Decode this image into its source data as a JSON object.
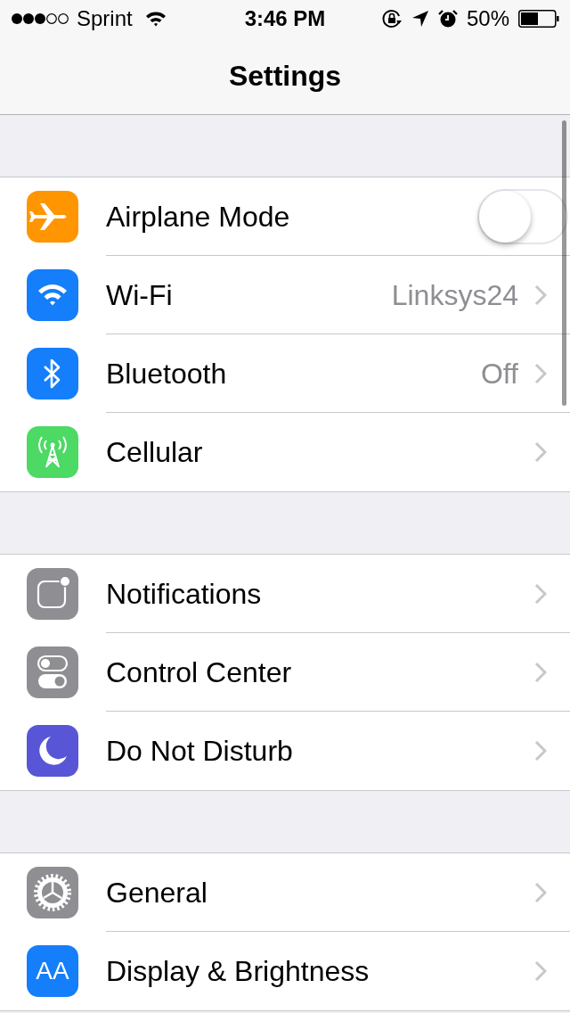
{
  "status_bar": {
    "carrier": "Sprint",
    "time": "3:46 PM",
    "battery": "50%"
  },
  "nav": {
    "title": "Settings"
  },
  "groups": [
    {
      "rows": [
        {
          "kind": "toggle",
          "label": "Airplane Mode",
          "color": "#ff9500",
          "on": false
        },
        {
          "kind": "detail",
          "label": "Wi-Fi",
          "color": "#147efb",
          "value": "Linksys24"
        },
        {
          "kind": "detail",
          "label": "Bluetooth",
          "color": "#147efb",
          "value": "Off"
        },
        {
          "kind": "detail",
          "label": "Cellular",
          "color": "#4cd964"
        }
      ]
    },
    {
      "rows": [
        {
          "kind": "detail",
          "label": "Notifications",
          "color": "#8e8e93"
        },
        {
          "kind": "detail",
          "label": "Control Center",
          "color": "#8e8e93"
        },
        {
          "kind": "detail",
          "label": "Do Not Disturb",
          "color": "#5856d6"
        }
      ]
    },
    {
      "rows": [
        {
          "kind": "detail",
          "label": "General",
          "color": "#8e8e93"
        },
        {
          "kind": "detail",
          "label": "Display & Brightness",
          "color": "#147efb",
          "icon_text": "AA"
        }
      ]
    }
  ]
}
